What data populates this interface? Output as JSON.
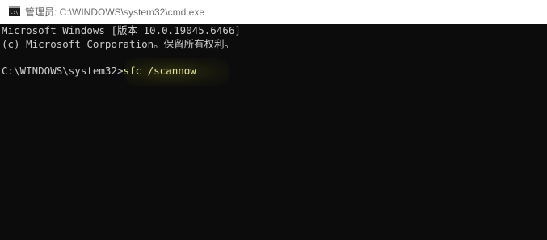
{
  "window": {
    "title": "管理员: C:\\WINDOWS\\system32\\cmd.exe",
    "icon": "cmd-console-icon"
  },
  "console": {
    "lines": [
      "Microsoft Windows [版本 10.0.19045.6466]",
      "(c) Microsoft Corporation。保留所有权利。"
    ],
    "prompt": "C:\\WINDOWS\\system32>",
    "command": "sfc /scannow"
  },
  "colors": {
    "background": "#0c0c0c",
    "text": "#cccccc",
    "titlebar": "#ffffff"
  }
}
